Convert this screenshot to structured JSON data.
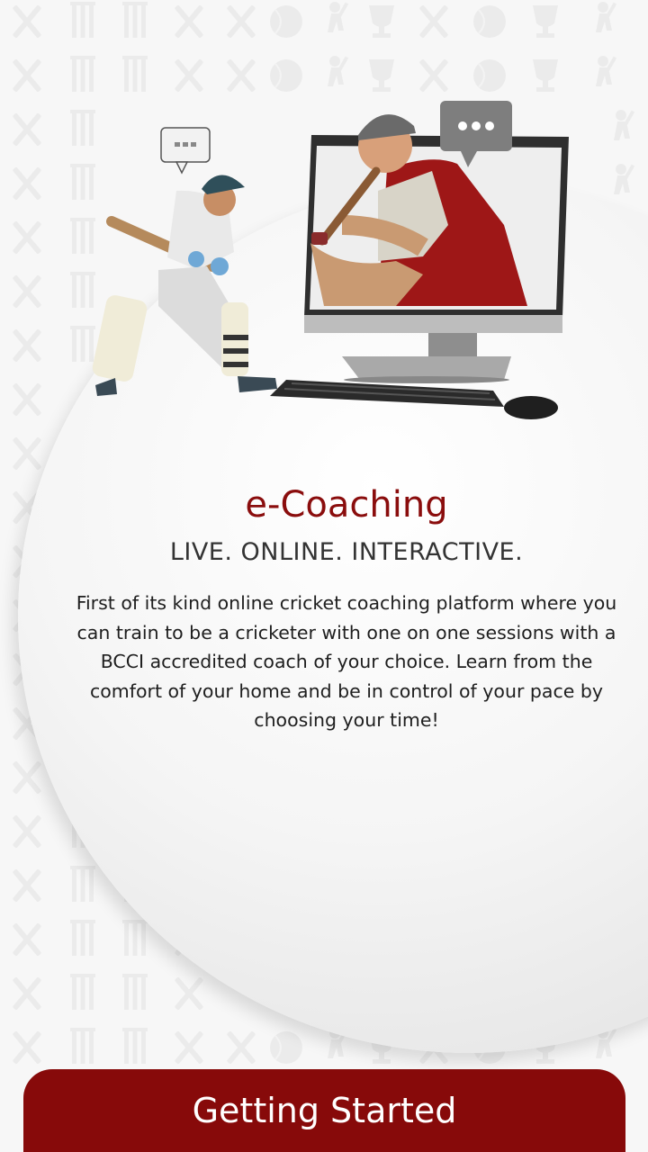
{
  "onboarding": {
    "title": "e-Coaching",
    "subtitle": "LIVE. ONLINE. INTERACTIVE.",
    "description": "First of its kind online cricket coaching platform where you can train to be a cricketer with one on one sessions with a BCCI accredited coach of your choice. Learn from the comfort of your home and be in control of your pace by choosing your time!"
  },
  "cta": {
    "label": "Getting Started"
  },
  "illustration": {
    "icons": [
      "cricket-bat-icon",
      "trophy-icon",
      "ball-icon",
      "batsman-icon",
      "stumps-icon"
    ]
  },
  "colors": {
    "brand": "#870a0a",
    "title": "#8a0d0d",
    "background": "#f7f7f7"
  }
}
